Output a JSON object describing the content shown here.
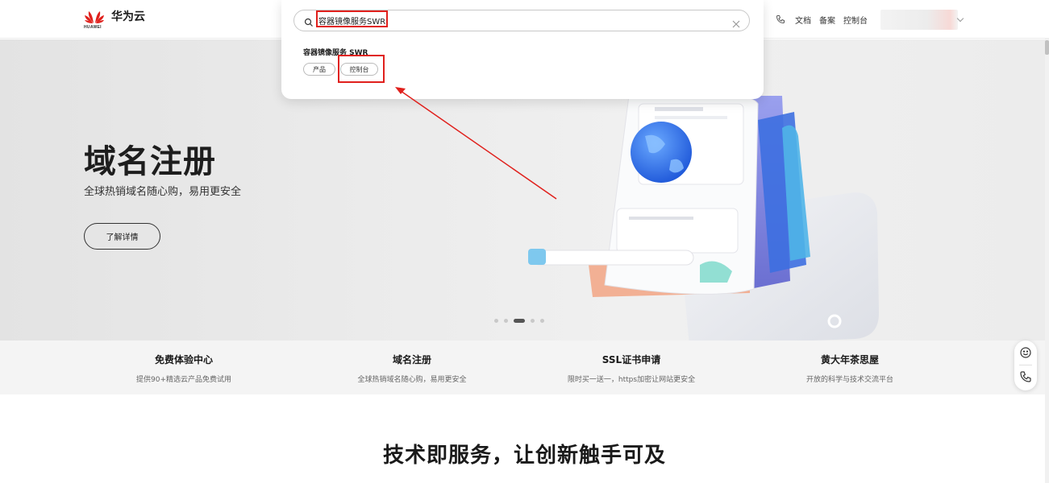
{
  "brand": {
    "name": "华为云",
    "wordmark": "HUAWEI",
    "color": "#e0201c"
  },
  "nav": {
    "links": [
      "文档",
      "备案",
      "控制台"
    ],
    "phone_icon": "phone-icon"
  },
  "search": {
    "value": "容器镜像服务SWR",
    "result_title": "容器镜像服务 SWR",
    "tags": [
      "产品",
      "控制台"
    ]
  },
  "hero": {
    "title": "域名注册",
    "subtitle": "全球热销域名随心购，易用更安全",
    "button": "了解详情",
    "slides": 5,
    "active_slide": 3
  },
  "features": [
    {
      "title": "免费体验中心",
      "desc": "提供90+精选云产品免费试用"
    },
    {
      "title": "域名注册",
      "desc": "全球热销域名随心购，易用更安全"
    },
    {
      "title": "SSL证书申请",
      "desc": "限时买一送一，https加密让网站更安全"
    },
    {
      "title": "黄大年茶思屋",
      "desc": "开放的科学与技术交流平台"
    }
  ],
  "section_title": "技术即服务，让创新触手可及",
  "side_tools": [
    "smile-icon",
    "phone-icon"
  ],
  "annotation_color": "#e0201c"
}
